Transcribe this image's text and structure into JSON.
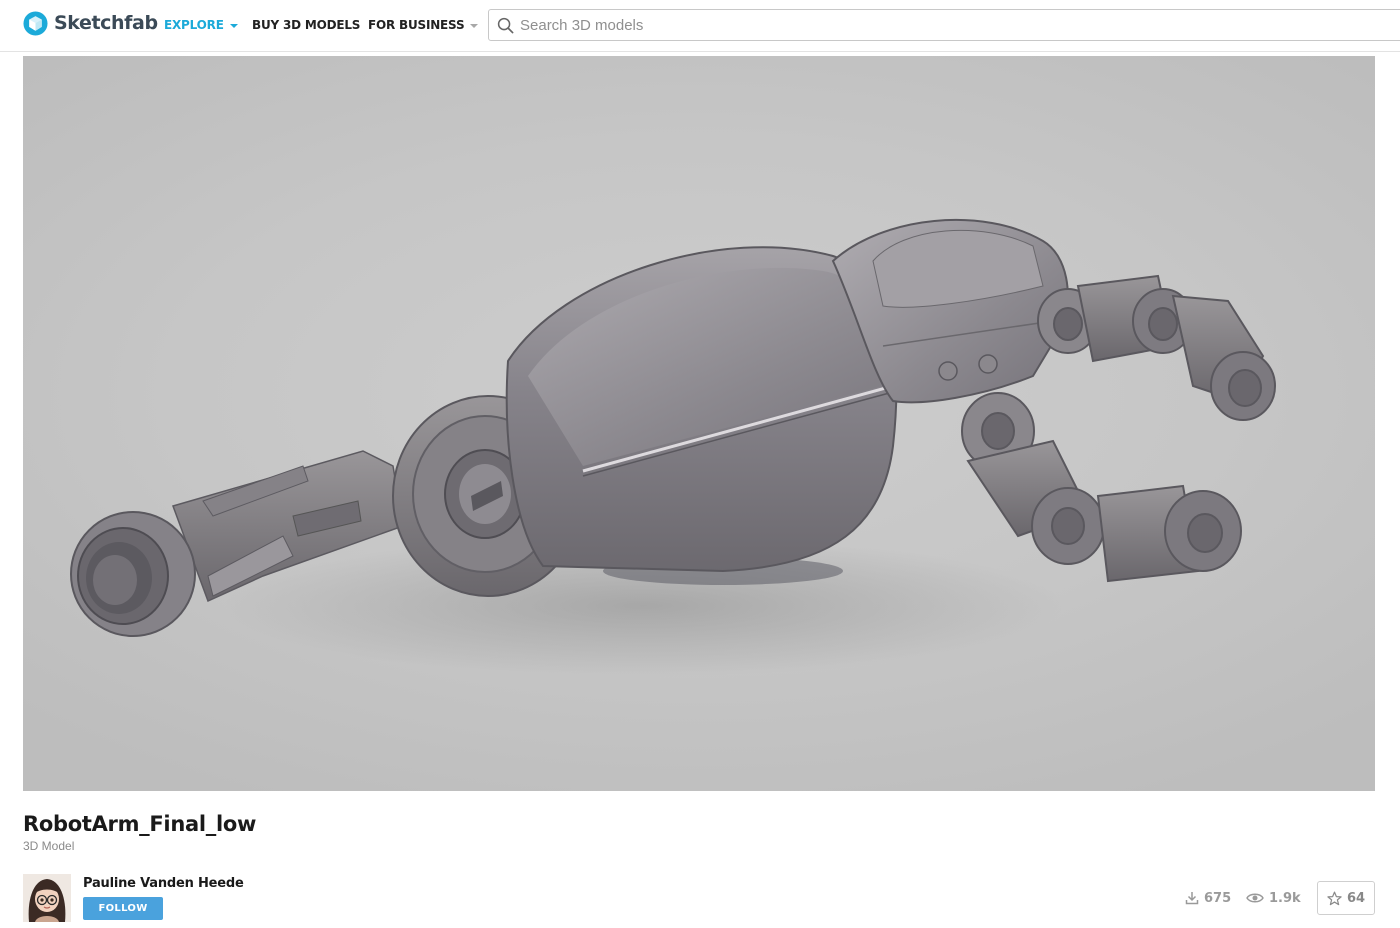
{
  "header": {
    "logo_text": "Sketchfab",
    "nav": {
      "explore": "EXPLORE",
      "buy": "BUY 3D MODELS",
      "business": "FOR BUSINESS"
    },
    "search": {
      "placeholder": "Search 3D models",
      "value": ""
    }
  },
  "viewer": {
    "background": "#c6c6c6",
    "model_color": "#7f7c81"
  },
  "model": {
    "title": "RobotArm_Final_low",
    "type": "3D Model"
  },
  "author": {
    "name": "Pauline Vanden Heede",
    "follow_label": "FOLLOW"
  },
  "stats": {
    "downloads": "675",
    "views": "1.9k",
    "likes": "64"
  },
  "colors": {
    "brand": "#1caad9",
    "follow_button": "#4aa2dd"
  },
  "icons": {
    "logo": "sketchfab-cube-icon",
    "search": "search-icon",
    "downloads": "download-icon",
    "views": "eye-icon",
    "likes": "star-icon"
  }
}
